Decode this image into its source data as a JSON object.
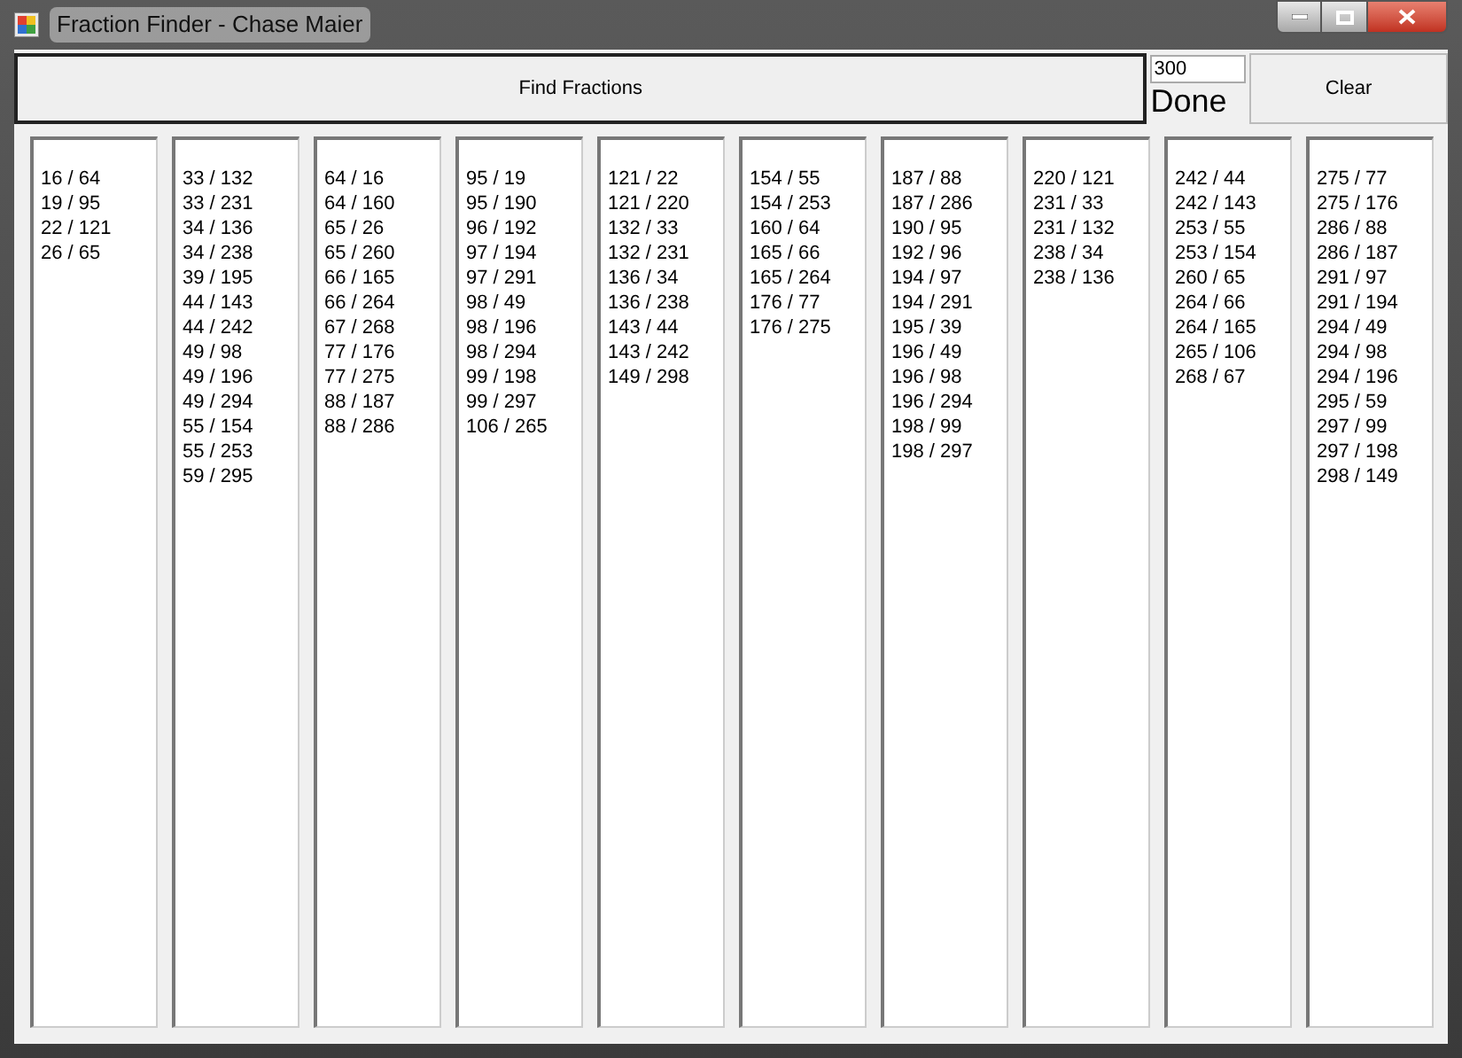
{
  "window": {
    "title": "Fraction Finder - Chase Maier"
  },
  "find_button": "Find Fractions",
  "limit_field": {
    "value": "300"
  },
  "status": "Done",
  "clear_button": "Clear",
  "columns": [
    [
      "16 / 64",
      "19 / 95",
      "22 / 121",
      "26 / 65"
    ],
    [
      "33 / 132",
      "33 / 231",
      "34 / 136",
      "34 / 238",
      "39 / 195",
      "44 / 143",
      "44 / 242",
      "49 / 98",
      "49 / 196",
      "49 / 294",
      "55 / 154",
      "55 / 253",
      "59 / 295"
    ],
    [
      "64 / 16",
      "64 / 160",
      "65 / 26",
      "65 / 260",
      "66 / 165",
      "66 / 264",
      "67 / 268",
      "77 / 176",
      "77 / 275",
      "88 / 187",
      "88 / 286"
    ],
    [
      "95 / 19",
      "95 / 190",
      "96 / 192",
      "97 / 194",
      "97 / 291",
      "98 / 49",
      "98 / 196",
      "98 / 294",
      "99 / 198",
      "99 / 297",
      "106 / 265"
    ],
    [
      "121 / 22",
      "121 / 220",
      "132 / 33",
      "132 / 231",
      "136 / 34",
      "136 / 238",
      "143 / 44",
      "143 / 242",
      "149 / 298"
    ],
    [
      "154 / 55",
      "154 / 253",
      "160 / 64",
      "165 / 66",
      "165 / 264",
      "176 / 77",
      "176 / 275"
    ],
    [
      "187 / 88",
      "187 / 286",
      "190 / 95",
      "192 / 96",
      "194 / 97",
      "194 / 291",
      "195 / 39",
      "196 / 49",
      "196 / 98",
      "196 / 294",
      "198 / 99",
      "198 / 297"
    ],
    [
      "220 / 121",
      "231 / 33",
      "231 / 132",
      "238 / 34",
      "238 / 136"
    ],
    [
      "242 / 44",
      "242 / 143",
      "253 / 55",
      "253 / 154",
      "260 / 65",
      "264 / 66",
      "264 / 165",
      "265 / 106",
      "268 / 67"
    ],
    [
      "275 / 77",
      "275 / 176",
      "286 / 88",
      "286 / 187",
      "291 / 97",
      "291 / 194",
      "294 / 49",
      "294 / 98",
      "294 / 196",
      "295 / 59",
      "297 / 99",
      "297 / 198",
      "298 / 149"
    ]
  ]
}
